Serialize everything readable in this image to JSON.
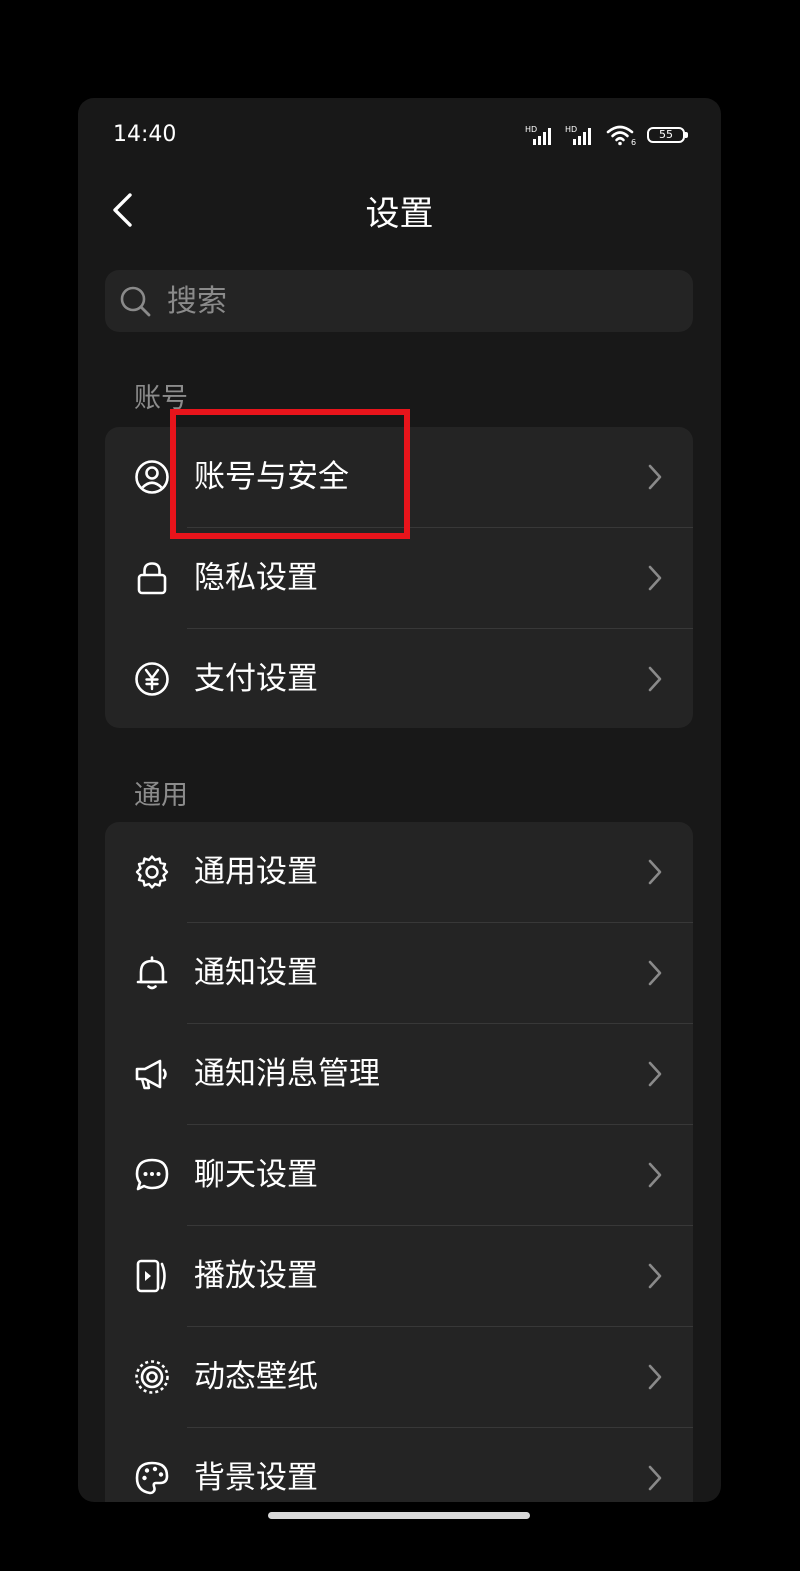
{
  "status_bar": {
    "time": "14:40",
    "battery": "55",
    "network_label_1": "HD",
    "network_label_2": "HD",
    "wifi_label": "6"
  },
  "nav": {
    "title": "设置",
    "back_icon": "chevron-left-icon"
  },
  "search": {
    "placeholder": "搜索",
    "value": ""
  },
  "sections": [
    {
      "label": "账号",
      "items": [
        {
          "label": "账号与安全",
          "icon": "user-circle-icon"
        },
        {
          "label": "隐私设置",
          "icon": "lock-icon"
        },
        {
          "label": "支付设置",
          "icon": "yen-icon"
        }
      ]
    },
    {
      "label": "通用",
      "items": [
        {
          "label": "通用设置",
          "icon": "gear-icon"
        },
        {
          "label": "通知设置",
          "icon": "bell-icon"
        },
        {
          "label": "通知消息管理",
          "icon": "megaphone-icon"
        },
        {
          "label": "聊天设置",
          "icon": "chat-bubble-icon"
        },
        {
          "label": "播放设置",
          "icon": "play-card-icon"
        },
        {
          "label": "动态壁纸",
          "icon": "live-wallpaper-icon"
        },
        {
          "label": "背景设置",
          "icon": "palette-icon"
        }
      ]
    }
  ],
  "colors": {
    "background": "#000000",
    "screen": "#181818",
    "card": "#242424",
    "highlight": "#e8141b",
    "text": "#ffffff",
    "muted": "#8c8c8c"
  }
}
